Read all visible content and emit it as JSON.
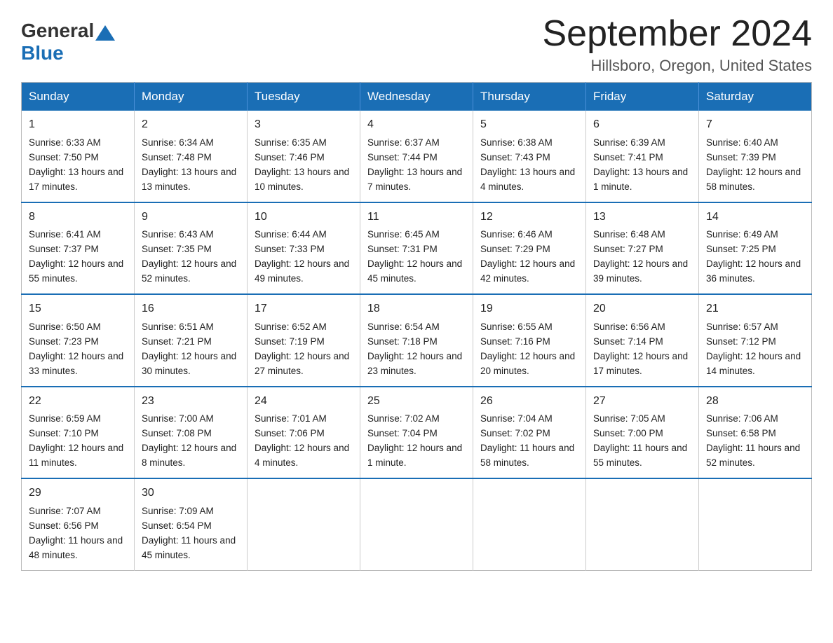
{
  "logo": {
    "general": "General",
    "blue": "Blue"
  },
  "title": "September 2024",
  "location": "Hillsboro, Oregon, United States",
  "weekdays": [
    "Sunday",
    "Monday",
    "Tuesday",
    "Wednesday",
    "Thursday",
    "Friday",
    "Saturday"
  ],
  "weeks": [
    [
      {
        "day": "1",
        "sunrise": "Sunrise: 6:33 AM",
        "sunset": "Sunset: 7:50 PM",
        "daylight": "Daylight: 13 hours and 17 minutes."
      },
      {
        "day": "2",
        "sunrise": "Sunrise: 6:34 AM",
        "sunset": "Sunset: 7:48 PM",
        "daylight": "Daylight: 13 hours and 13 minutes."
      },
      {
        "day": "3",
        "sunrise": "Sunrise: 6:35 AM",
        "sunset": "Sunset: 7:46 PM",
        "daylight": "Daylight: 13 hours and 10 minutes."
      },
      {
        "day": "4",
        "sunrise": "Sunrise: 6:37 AM",
        "sunset": "Sunset: 7:44 PM",
        "daylight": "Daylight: 13 hours and 7 minutes."
      },
      {
        "day": "5",
        "sunrise": "Sunrise: 6:38 AM",
        "sunset": "Sunset: 7:43 PM",
        "daylight": "Daylight: 13 hours and 4 minutes."
      },
      {
        "day": "6",
        "sunrise": "Sunrise: 6:39 AM",
        "sunset": "Sunset: 7:41 PM",
        "daylight": "Daylight: 13 hours and 1 minute."
      },
      {
        "day": "7",
        "sunrise": "Sunrise: 6:40 AM",
        "sunset": "Sunset: 7:39 PM",
        "daylight": "Daylight: 12 hours and 58 minutes."
      }
    ],
    [
      {
        "day": "8",
        "sunrise": "Sunrise: 6:41 AM",
        "sunset": "Sunset: 7:37 PM",
        "daylight": "Daylight: 12 hours and 55 minutes."
      },
      {
        "day": "9",
        "sunrise": "Sunrise: 6:43 AM",
        "sunset": "Sunset: 7:35 PM",
        "daylight": "Daylight: 12 hours and 52 minutes."
      },
      {
        "day": "10",
        "sunrise": "Sunrise: 6:44 AM",
        "sunset": "Sunset: 7:33 PM",
        "daylight": "Daylight: 12 hours and 49 minutes."
      },
      {
        "day": "11",
        "sunrise": "Sunrise: 6:45 AM",
        "sunset": "Sunset: 7:31 PM",
        "daylight": "Daylight: 12 hours and 45 minutes."
      },
      {
        "day": "12",
        "sunrise": "Sunrise: 6:46 AM",
        "sunset": "Sunset: 7:29 PM",
        "daylight": "Daylight: 12 hours and 42 minutes."
      },
      {
        "day": "13",
        "sunrise": "Sunrise: 6:48 AM",
        "sunset": "Sunset: 7:27 PM",
        "daylight": "Daylight: 12 hours and 39 minutes."
      },
      {
        "day": "14",
        "sunrise": "Sunrise: 6:49 AM",
        "sunset": "Sunset: 7:25 PM",
        "daylight": "Daylight: 12 hours and 36 minutes."
      }
    ],
    [
      {
        "day": "15",
        "sunrise": "Sunrise: 6:50 AM",
        "sunset": "Sunset: 7:23 PM",
        "daylight": "Daylight: 12 hours and 33 minutes."
      },
      {
        "day": "16",
        "sunrise": "Sunrise: 6:51 AM",
        "sunset": "Sunset: 7:21 PM",
        "daylight": "Daylight: 12 hours and 30 minutes."
      },
      {
        "day": "17",
        "sunrise": "Sunrise: 6:52 AM",
        "sunset": "Sunset: 7:19 PM",
        "daylight": "Daylight: 12 hours and 27 minutes."
      },
      {
        "day": "18",
        "sunrise": "Sunrise: 6:54 AM",
        "sunset": "Sunset: 7:18 PM",
        "daylight": "Daylight: 12 hours and 23 minutes."
      },
      {
        "day": "19",
        "sunrise": "Sunrise: 6:55 AM",
        "sunset": "Sunset: 7:16 PM",
        "daylight": "Daylight: 12 hours and 20 minutes."
      },
      {
        "day": "20",
        "sunrise": "Sunrise: 6:56 AM",
        "sunset": "Sunset: 7:14 PM",
        "daylight": "Daylight: 12 hours and 17 minutes."
      },
      {
        "day": "21",
        "sunrise": "Sunrise: 6:57 AM",
        "sunset": "Sunset: 7:12 PM",
        "daylight": "Daylight: 12 hours and 14 minutes."
      }
    ],
    [
      {
        "day": "22",
        "sunrise": "Sunrise: 6:59 AM",
        "sunset": "Sunset: 7:10 PM",
        "daylight": "Daylight: 12 hours and 11 minutes."
      },
      {
        "day": "23",
        "sunrise": "Sunrise: 7:00 AM",
        "sunset": "Sunset: 7:08 PM",
        "daylight": "Daylight: 12 hours and 8 minutes."
      },
      {
        "day": "24",
        "sunrise": "Sunrise: 7:01 AM",
        "sunset": "Sunset: 7:06 PM",
        "daylight": "Daylight: 12 hours and 4 minutes."
      },
      {
        "day": "25",
        "sunrise": "Sunrise: 7:02 AM",
        "sunset": "Sunset: 7:04 PM",
        "daylight": "Daylight: 12 hours and 1 minute."
      },
      {
        "day": "26",
        "sunrise": "Sunrise: 7:04 AM",
        "sunset": "Sunset: 7:02 PM",
        "daylight": "Daylight: 11 hours and 58 minutes."
      },
      {
        "day": "27",
        "sunrise": "Sunrise: 7:05 AM",
        "sunset": "Sunset: 7:00 PM",
        "daylight": "Daylight: 11 hours and 55 minutes."
      },
      {
        "day": "28",
        "sunrise": "Sunrise: 7:06 AM",
        "sunset": "Sunset: 6:58 PM",
        "daylight": "Daylight: 11 hours and 52 minutes."
      }
    ],
    [
      {
        "day": "29",
        "sunrise": "Sunrise: 7:07 AM",
        "sunset": "Sunset: 6:56 PM",
        "daylight": "Daylight: 11 hours and 48 minutes."
      },
      {
        "day": "30",
        "sunrise": "Sunrise: 7:09 AM",
        "sunset": "Sunset: 6:54 PM",
        "daylight": "Daylight: 11 hours and 45 minutes."
      },
      null,
      null,
      null,
      null,
      null
    ]
  ]
}
